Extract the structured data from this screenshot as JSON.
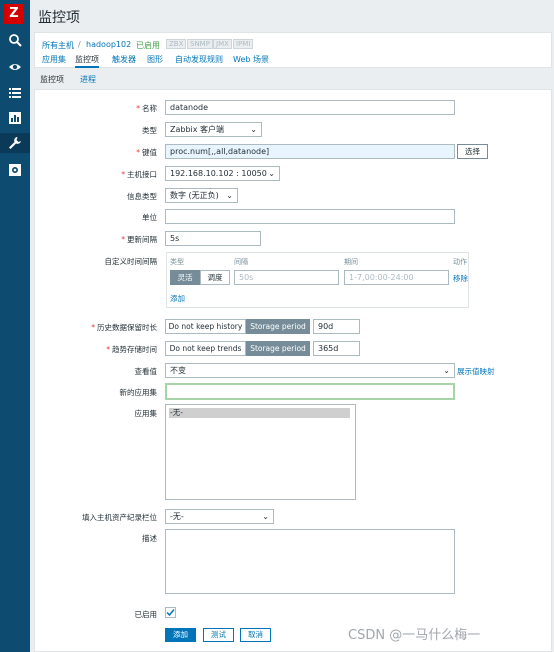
{
  "sidebar": {
    "logo": "Z",
    "icons": [
      "search-icon",
      "eye-icon",
      "list-icon",
      "chart-icon",
      "wrench-icon",
      "gear-icon"
    ]
  },
  "page": {
    "title": "监控项"
  },
  "breadcrumb": {
    "all_hosts": "所有主机",
    "sep": "/",
    "host": "hadoop102",
    "status": "已启用",
    "availability": [
      "ZBX",
      "SNMP",
      "JMX",
      "IPMI"
    ]
  },
  "subnav": {
    "apps": "应用集",
    "items": "监控项",
    "triggers": "触发器",
    "graphs": "图形",
    "discovery": "自动发现规则",
    "web": "Web 场景"
  },
  "tabs": {
    "item": "监控项",
    "process": "进程"
  },
  "form": {
    "name": {
      "label": "名称",
      "value": "datanode"
    },
    "type": {
      "label": "类型",
      "value": "Zabbix 客户端"
    },
    "key": {
      "label": "键值",
      "value": "proc.num[,,all,datanode]",
      "select_btn": "选择"
    },
    "interface": {
      "label": "主机接口",
      "value": "192.168.10.102 : 10050"
    },
    "info_type": {
      "label": "信息类型",
      "value": "数字 (无正负)"
    },
    "units": {
      "label": "单位",
      "value": ""
    },
    "update": {
      "label": "更新间隔",
      "value": "5s"
    },
    "custom_intervals": {
      "label": "自定义时间间隔",
      "col_type": "类型",
      "col_interval": "间隔",
      "col_period": "期间",
      "col_action": "动作",
      "seg_flexible": "灵活",
      "seg_scheduling": "调度",
      "interval_placeholder": "50s",
      "period_placeholder": "1-7,00:00-24:00",
      "remove": "移除",
      "add": "添加"
    },
    "history": {
      "label": "历史数据保留时长",
      "opt_no": "Do not keep history",
      "opt_storage": "Storage period",
      "value": "90d"
    },
    "trends": {
      "label": "趋势存储时间",
      "opt_no": "Do not keep trends",
      "opt_storage": "Storage period",
      "value": "365d"
    },
    "valuemap": {
      "label": "查看值",
      "value": "不变",
      "link": "展示值映射"
    },
    "new_app": {
      "label": "新的应用集",
      "value": ""
    },
    "applications": {
      "label": "应用集",
      "selected": "-无-"
    },
    "inventory": {
      "label": "填入主机资产纪录栏位",
      "value": "-无-"
    },
    "description": {
      "label": "描述"
    },
    "enabled": {
      "label": "已启用",
      "checked": true
    }
  },
  "actions": {
    "add": "添加",
    "test": "测试",
    "cancel": "取消"
  },
  "watermark": "CSDN @一马什么梅一"
}
